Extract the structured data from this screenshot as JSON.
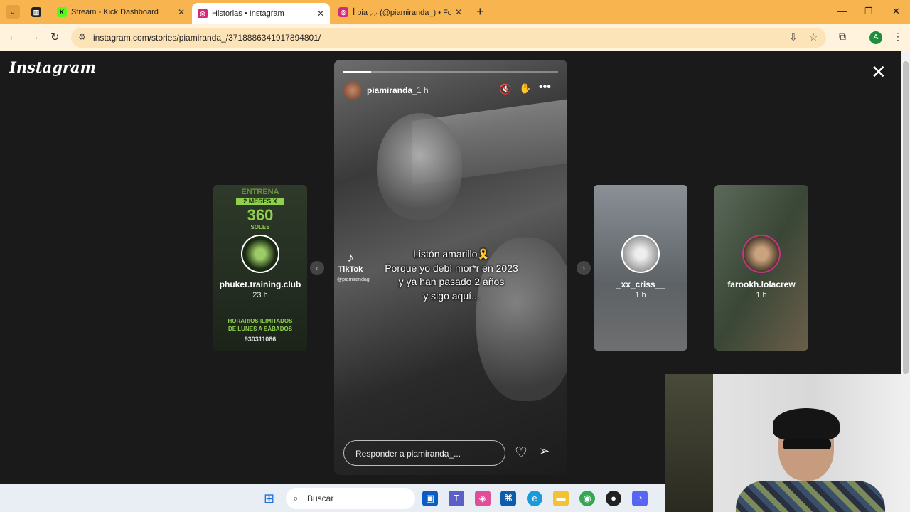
{
  "browser": {
    "tabs": [
      {
        "label": "Stream - Kick Dashboard",
        "favicon": "K",
        "favicon_color": "#53fc18"
      },
      {
        "label": "Historias • Instagram",
        "favicon": "◎",
        "favicon_color": "#d62976"
      },
      {
        "label": "ꟾ pia ⸝⸝ (@piamiranda_) • Foto",
        "favicon": "◎",
        "favicon_color": "#d62976"
      }
    ],
    "url": "instagram.com/stories/piamiranda_/3718886341917894801/",
    "profile_initial": "A"
  },
  "instagram": {
    "logo": "Instagram",
    "story": {
      "username": "piamiranda_",
      "time_ago": "1 h",
      "progress": 0.13,
      "caption_lines": [
        "Listón amarillo🎗️",
        "Porque yo debí mor*r en 2023",
        "y ya han pasado 2 años",
        "y sigo aquí..."
      ],
      "tiktok_label": "TikTok",
      "tiktok_handle": "@piamirandag",
      "reply_placeholder": "Responder a piamiranda_..."
    },
    "side_stories": [
      {
        "username": "phuket.training.club",
        "time_ago": "23 h",
        "poster": {
          "top": "ENTRENA",
          "promo": "2 MESES X",
          "price": "360",
          "currency": "SOLES",
          "bottom1": "HORARIOS ILIMITADOS",
          "bottom2": "DE LUNES A SÁBADOS",
          "phone": "930311086"
        }
      },
      {
        "username": "_xx_criss__",
        "time_ago": "1 h"
      },
      {
        "username": "farookh.lolacrew",
        "time_ago": "1 h"
      }
    ]
  },
  "taskbar": {
    "search_placeholder": "Buscar"
  }
}
